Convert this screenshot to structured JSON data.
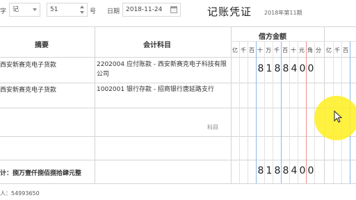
{
  "toolbar": {
    "word_label": "字",
    "voucher_word": "记",
    "number_value": "51",
    "number_suffix": "号",
    "date_label": "日期",
    "date_value": "2018-11-24",
    "title": "记账凭证",
    "period": "2018年第11期"
  },
  "table": {
    "col_summary": "摘要",
    "col_account": "会计科目",
    "col_debit": "借方金额",
    "debit_units": [
      "亿",
      "千",
      "百",
      "十",
      "万",
      "千",
      "百",
      "十",
      "元",
      "角",
      "分"
    ],
    "credit_units": [
      "亿",
      "千",
      "百"
    ],
    "rows": [
      {
        "summary": "西安新赛克电子货款",
        "account": "2202004 应付账款 - 西安新赛克电子科技有限公司",
        "debit": [
          "8",
          "1",
          "8",
          "8",
          "4",
          "0",
          "0"
        ]
      },
      {
        "summary": "西安新赛克电子货款",
        "account": "1002001 银行存款 - 招商银行唐延路支行",
        "debit": []
      },
      {
        "summary": "",
        "account": "",
        "account_hint": "科目",
        "debit": []
      }
    ],
    "total_label": "计：捌万壹仟捌佰捌拾肆元整",
    "total_debit": [
      "8",
      "1",
      "8",
      "8",
      "4",
      "0",
      "0"
    ]
  },
  "footer": {
    "preparer": "人：54993650"
  }
}
